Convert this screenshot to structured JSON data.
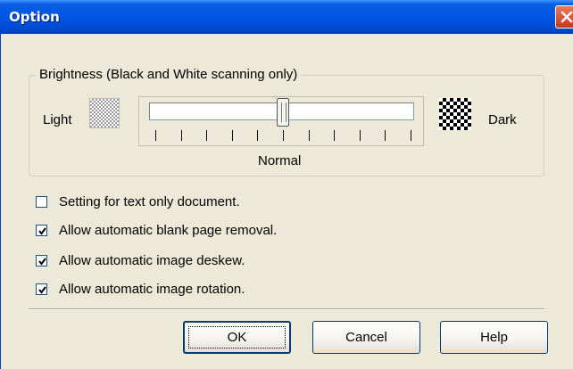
{
  "window": {
    "title": "Option"
  },
  "brightness": {
    "group_label": "Brightness (Black and White scanning only)",
    "light_label": "Light",
    "dark_label": "Dark",
    "center_label": "Normal",
    "slider_level_fraction": 0.5,
    "tick_count": 11
  },
  "options": [
    {
      "label": "Setting for text only document.",
      "checked": false
    },
    {
      "label": "Allow automatic blank page removal.",
      "checked": true
    },
    {
      "label": "Allow automatic image deskew.",
      "checked": true
    },
    {
      "label": "Allow automatic image rotation.",
      "checked": true
    }
  ],
  "buttons": {
    "ok": "OK",
    "cancel": "Cancel",
    "help": "Help"
  },
  "colors": {
    "titlebar": "#0055E5",
    "dialog_bg": "#ECE9D8",
    "close": "#C5391A"
  }
}
